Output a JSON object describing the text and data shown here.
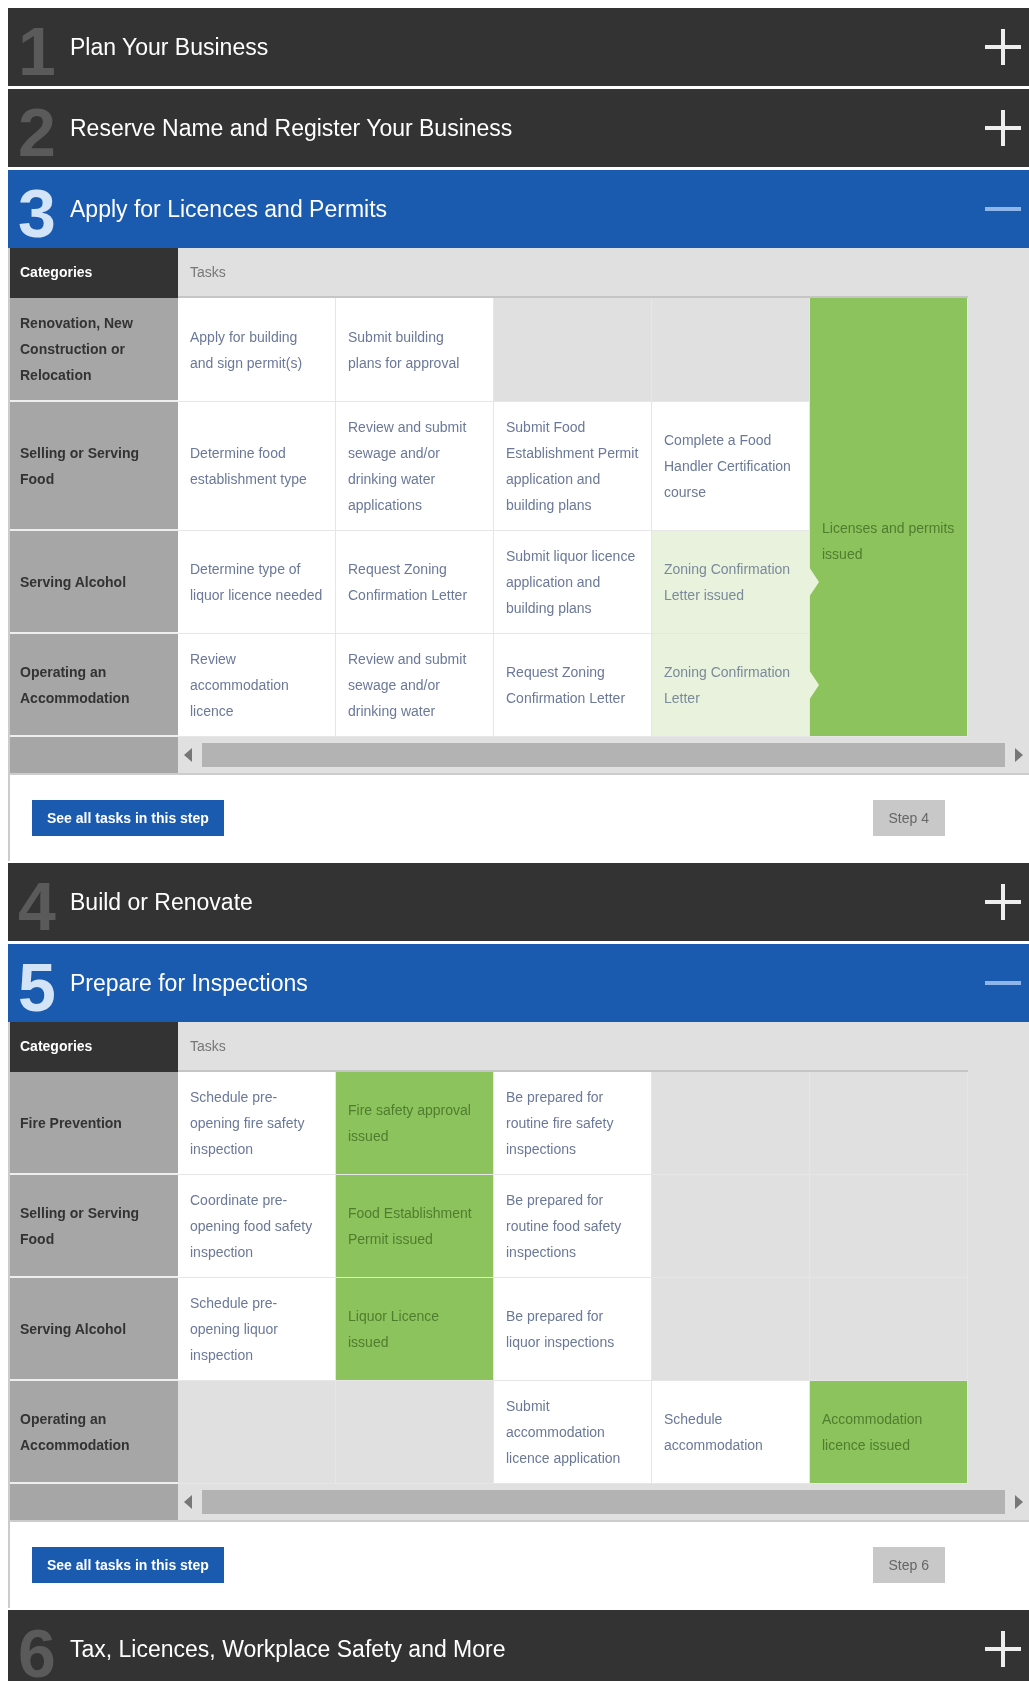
{
  "steps": [
    {
      "number": "1",
      "title": "Plan Your Business",
      "expanded": false
    },
    {
      "number": "2",
      "title": "Reserve Name and Register Your Business",
      "expanded": false
    },
    {
      "number": "3",
      "title": "Apply for Licences and Permits",
      "expanded": true,
      "table": {
        "category_header": "Categories",
        "tasks_header": "Tasks",
        "outcome": {
          "text": "Licenses and permits issued"
        },
        "rows": [
          {
            "category": "Renovation, New Construction or Relocation",
            "cells": [
              {
                "kind": "task",
                "text": "Apply for building and sign permit(s)"
              },
              {
                "kind": "task",
                "text": "Submit building plans for approval"
              },
              {
                "kind": "empty"
              },
              {
                "kind": "empty"
              }
            ]
          },
          {
            "category": "Selling or Serving Food",
            "cells": [
              {
                "kind": "task",
                "text": "Determine food establishment type"
              },
              {
                "kind": "task",
                "text": "Review and submit sewage and/or drinking water applications"
              },
              {
                "kind": "task",
                "text": "Submit Food Establishment Permit application and building plans"
              },
              {
                "kind": "task",
                "text": "Complete a Food Handler Certification course"
              }
            ]
          },
          {
            "category": "Serving Alcohol",
            "cells": [
              {
                "kind": "task",
                "text": "Determine type of liquor licence needed"
              },
              {
                "kind": "task",
                "text": "Request Zoning Confirmation Letter"
              },
              {
                "kind": "task",
                "text": "Submit liquor licence application and building plans"
              },
              {
                "kind": "pending",
                "text": "Zoning Confirmation Letter issued"
              }
            ]
          },
          {
            "category": "Operating an Accommodation",
            "cells": [
              {
                "kind": "task",
                "text": "Review accommodation licence"
              },
              {
                "kind": "task",
                "text": "Review and submit sewage and/or drinking water"
              },
              {
                "kind": "task",
                "text": "Request Zoning Confirmation Letter"
              },
              {
                "kind": "pending",
                "text": "Zoning Confirmation Letter"
              }
            ]
          }
        ]
      },
      "footer": {
        "button": "See all tasks in this step",
        "next": "Step 4"
      }
    },
    {
      "number": "4",
      "title": "Build or Renovate",
      "expanded": false
    },
    {
      "number": "5",
      "title": "Prepare for Inspections",
      "expanded": true,
      "table": {
        "category_header": "Categories",
        "tasks_header": "Tasks",
        "rows": [
          {
            "category": "Fire Prevention",
            "cells": [
              {
                "kind": "task",
                "text": "Schedule pre-opening fire safety inspection"
              },
              {
                "kind": "done",
                "text": "Fire safety approval issued"
              },
              {
                "kind": "task",
                "text": "Be prepared for routine fire safety inspections"
              },
              {
                "kind": "empty"
              },
              {
                "kind": "empty"
              }
            ]
          },
          {
            "category": "Selling or Serving Food",
            "cells": [
              {
                "kind": "task",
                "text": "Coordinate pre-opening food safety inspection"
              },
              {
                "kind": "done",
                "text": "Food Establishment Permit issued"
              },
              {
                "kind": "task",
                "text": "Be prepared for routine food safety inspections"
              },
              {
                "kind": "empty"
              },
              {
                "kind": "empty"
              }
            ]
          },
          {
            "category": "Serving Alcohol",
            "cells": [
              {
                "kind": "task",
                "text": "Schedule pre-opening liquor inspection"
              },
              {
                "kind": "done",
                "text": "Liquor Licence issued"
              },
              {
                "kind": "task",
                "text": "Be prepared for liquor inspections"
              },
              {
                "kind": "empty"
              },
              {
                "kind": "empty"
              }
            ]
          },
          {
            "category": "Operating an Accommodation",
            "cells": [
              {
                "kind": "empty"
              },
              {
                "kind": "empty"
              },
              {
                "kind": "task",
                "text": "Submit accommodation licence application"
              },
              {
                "kind": "task",
                "text": "Schedule accommodation"
              },
              {
                "kind": "done",
                "text": "Accommodation licence issued"
              }
            ]
          }
        ]
      },
      "footer": {
        "button": "See all tasks in this step",
        "next": "Step 6"
      }
    },
    {
      "number": "6",
      "title": "Tax, Licences, Workplace Safety and More",
      "expanded": false
    }
  ]
}
